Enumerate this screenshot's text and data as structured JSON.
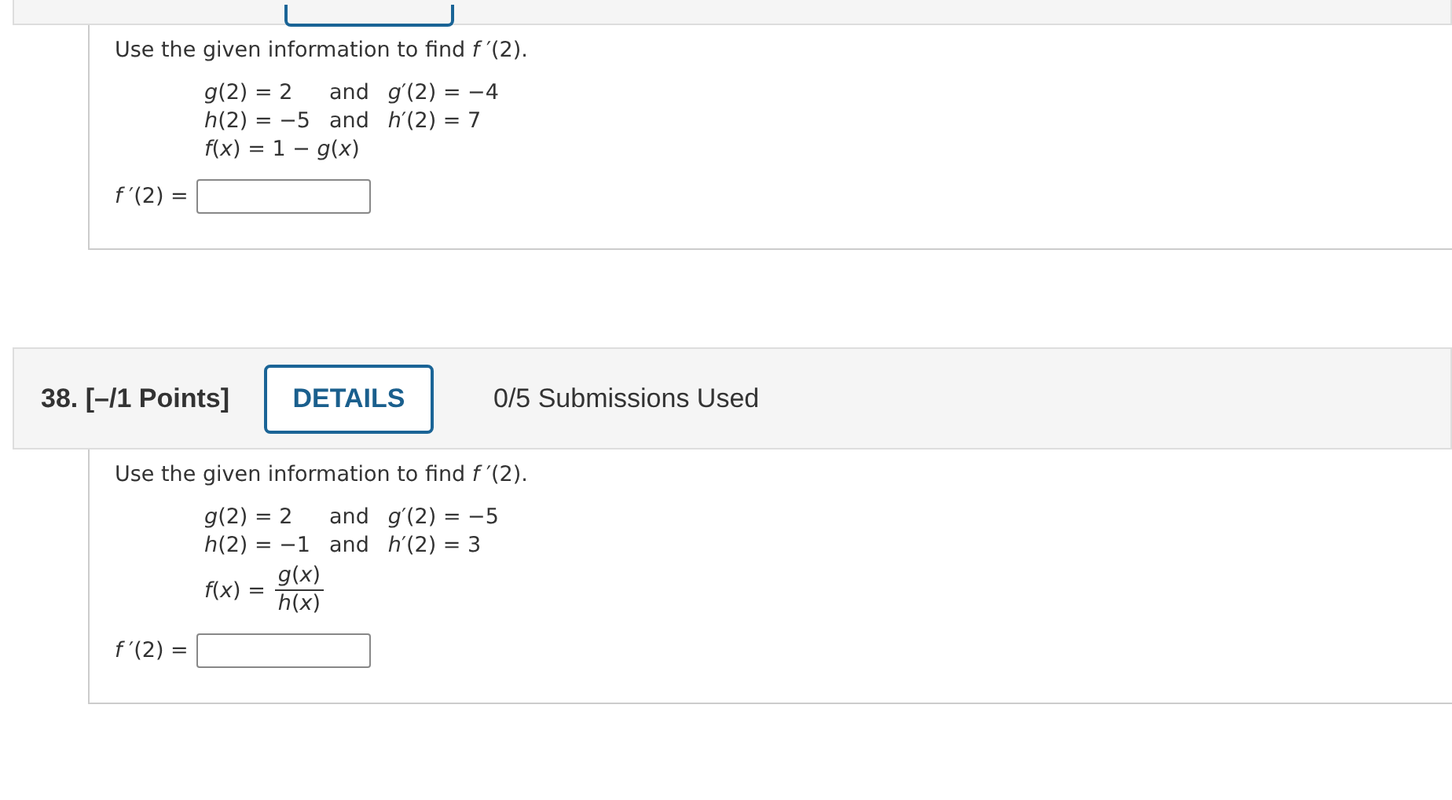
{
  "questions": [
    {
      "prompt": "Use the given information to find *f* ′(2).",
      "given": [
        {
          "left": "*g*(2) = 2",
          "connector": "and",
          "right": "*g*′(2) = −4"
        },
        {
          "left": "*h*(2) = −5",
          "connector": "and",
          "right": "*h*′(2) = 7"
        }
      ],
      "formula": {
        "kind": "line",
        "text": "*f*(*x*) = 1 − *g*(*x*)"
      },
      "answer": {
        "label": "*f* ′(2) ="
      }
    },
    {
      "number": "38.",
      "points": "[–/1 Points]",
      "details_button": "DETAILS",
      "submissions": "0/5 Submissions Used",
      "prompt": "Use the given information to find *f* ′(2).",
      "given": [
        {
          "left": "*g*(2) = 2",
          "connector": "and",
          "right": "*g*′(2) = −5"
        },
        {
          "left": "*h*(2) = −1",
          "connector": "and",
          "right": "*h*′(2) = 3"
        }
      ],
      "formula": {
        "kind": "fraction",
        "lhs": "*f*(*x*) =",
        "numerator": "*g*(*x*)",
        "denominator": "*h*(*x*)"
      },
      "answer": {
        "label": "*f* ′(2) ="
      }
    }
  ]
}
